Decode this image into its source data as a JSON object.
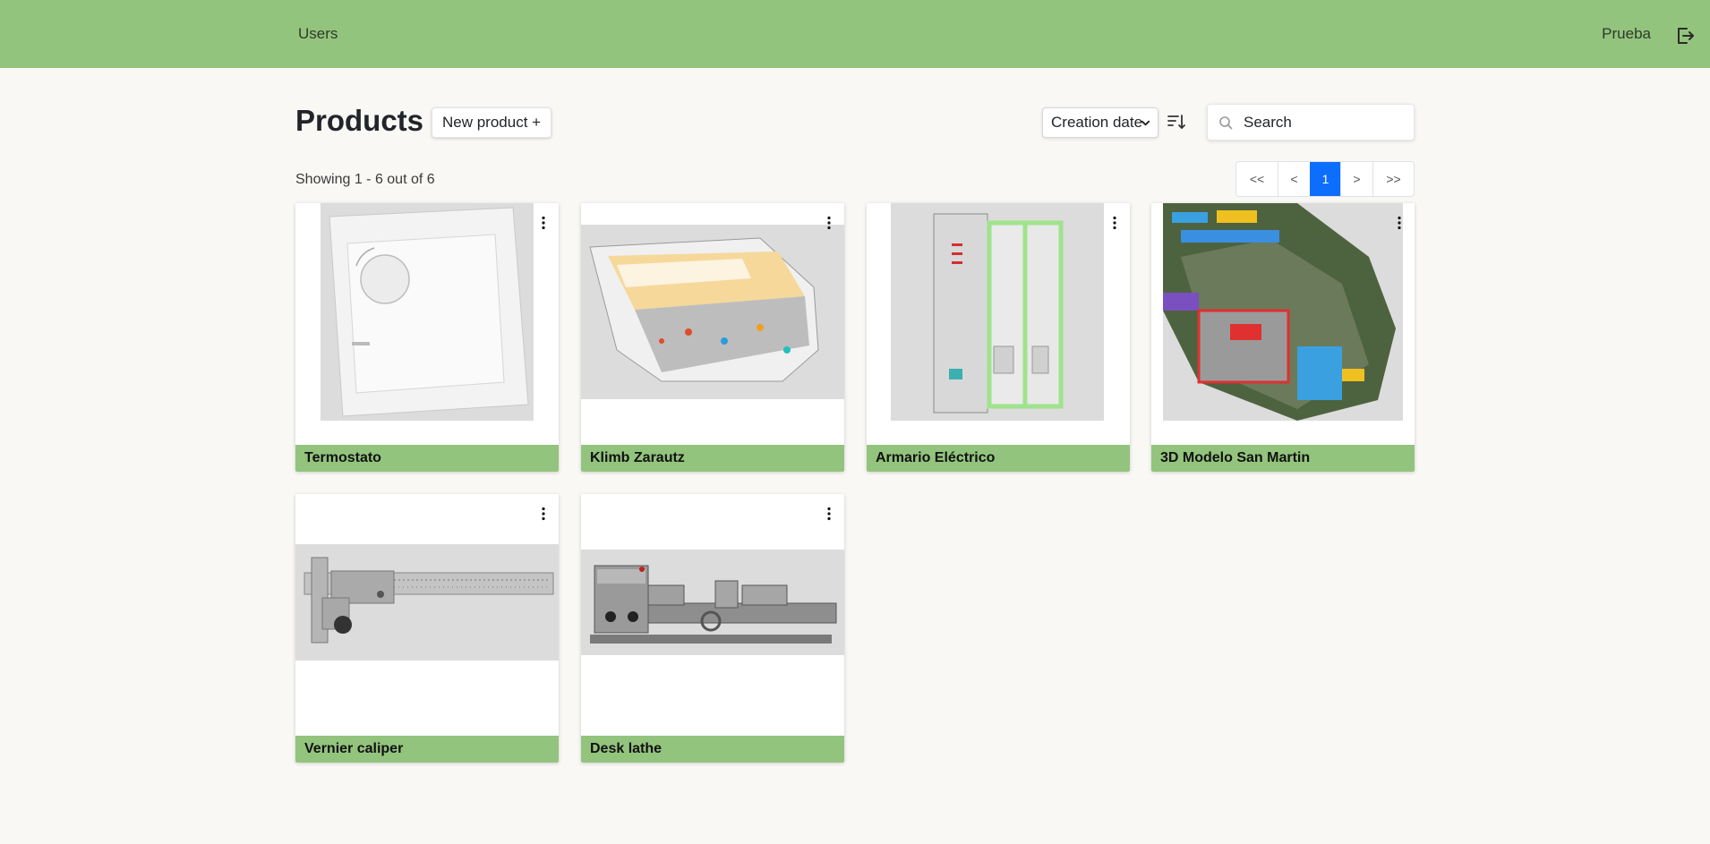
{
  "header": {
    "nav_users": "Users",
    "username": "Prueba",
    "logout_icon": "logout-icon",
    "color": "#93c47d"
  },
  "toolbar": {
    "title": "Products",
    "new_product_label": "New product +",
    "sort": {
      "selected": "Creation date",
      "direction_icon": "sort-descending-icon"
    },
    "search": {
      "placeholder": "Search",
      "icon": "search-icon"
    }
  },
  "list": {
    "showing_text": "Showing 1 - 6 out of 6",
    "pagination": {
      "first": "<<",
      "prev": "<",
      "current": "1",
      "next": ">",
      "last": ">>",
      "active_color": "#0d6efd"
    }
  },
  "products": [
    {
      "name": "Termostato"
    },
    {
      "name": "Klimb Zarautz"
    },
    {
      "name": "Armario Eléctrico"
    },
    {
      "name": "3D Modelo San Martin"
    },
    {
      "name": "Vernier caliper"
    },
    {
      "name": "Desk lathe"
    }
  ]
}
